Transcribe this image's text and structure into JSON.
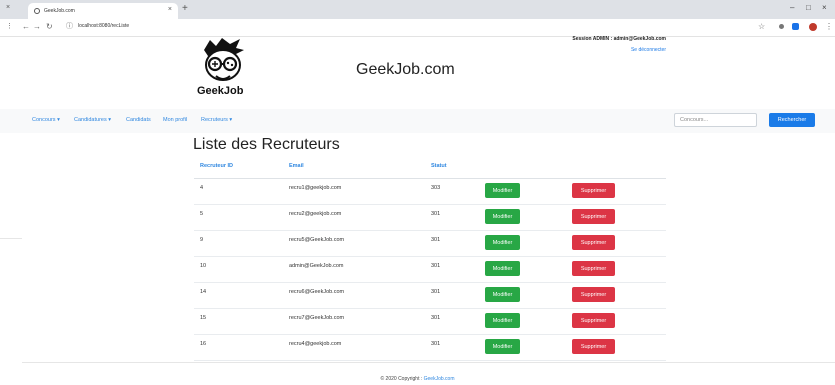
{
  "browser": {
    "tab_title": "GeekJob.com",
    "tab_close": "×",
    "new_tab": "+",
    "url": "localhost:8080/recListe",
    "window_controls": [
      "–",
      "□",
      "×"
    ]
  },
  "header": {
    "logo_text": "GeekJob",
    "site_title": "GeekJob.com",
    "session_text": "Session ADMIN : admin@GeekJob.com",
    "logout_label": "Se déconnecter"
  },
  "navbar": {
    "items": [
      {
        "label": "Concours ▾"
      },
      {
        "label": "Candidatures ▾"
      },
      {
        "label": "Candidats"
      },
      {
        "label": "Mon profil"
      },
      {
        "label": "Recruteurs ▾"
      }
    ],
    "search_placeholder": "Concours...",
    "search_button": "Rechercher"
  },
  "page": {
    "title": "Liste des Recruteurs"
  },
  "table": {
    "headers": [
      "Recruteur ID",
      "Email",
      "Statut"
    ],
    "modify_label": "Modifier",
    "delete_label": "Supprimer",
    "rows": [
      {
        "id": "4",
        "email": "recru1@geekjob.com",
        "statut": "303"
      },
      {
        "id": "5",
        "email": "recru2@geekjob.com",
        "statut": "301"
      },
      {
        "id": "9",
        "email": "recru5@GeekJob.com",
        "statut": "301"
      },
      {
        "id": "10",
        "email": "admin@GeekJob.com",
        "statut": "301"
      },
      {
        "id": "14",
        "email": "recru6@GeekJob.com",
        "statut": "301"
      },
      {
        "id": "15",
        "email": "recru7@GeekJob.com",
        "statut": "301"
      },
      {
        "id": "16",
        "email": "recru4@geekjob.com",
        "statut": "301"
      }
    ]
  },
  "footer": {
    "prefix": "© 2020 Copyright : ",
    "link": "GeekJob.com"
  },
  "colors": {
    "primary": "#1a7be8",
    "success": "#28a745",
    "danger": "#dc3545",
    "navbar_bg": "#f8f9fa"
  }
}
